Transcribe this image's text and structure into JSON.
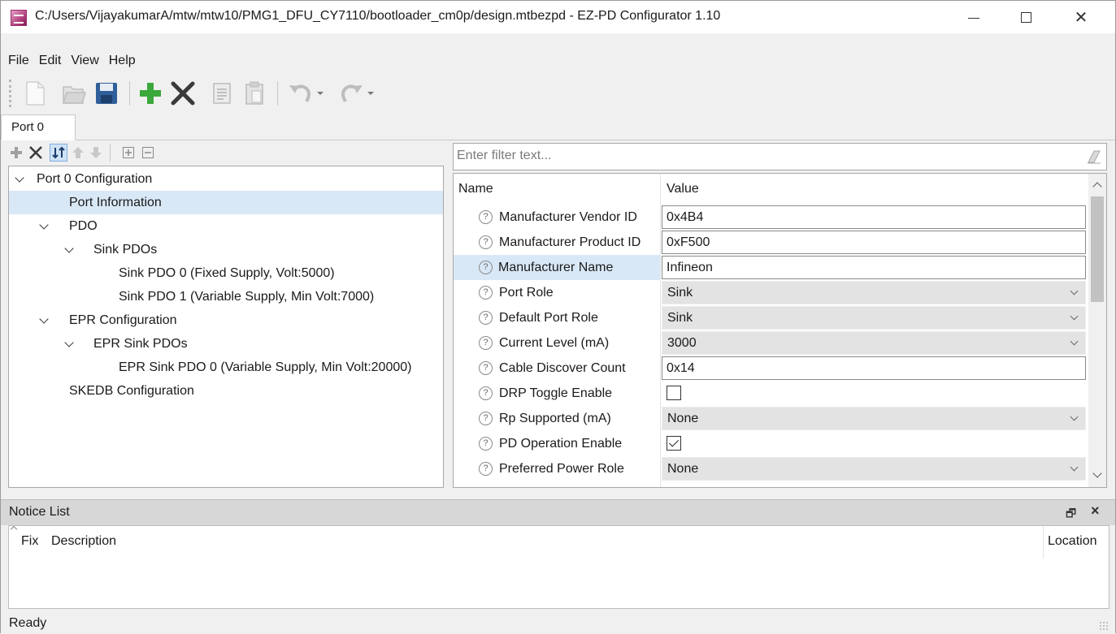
{
  "window": {
    "title": "C:/Users/VijayakumarA/mtw/mtw10/PMG1_DFU_CY7110/bootloader_cm0p/design.mtbezpd - EZ-PD Configurator 1.10",
    "minimize": "minimize-icon",
    "maximize": "maximize-icon",
    "close_glyph": "✕"
  },
  "menu": [
    "File",
    "Edit",
    "View",
    "Help"
  ],
  "toolbar_icons": [
    "new-file-icon",
    "open-folder-icon",
    "save-icon",
    "add-icon",
    "delete-icon",
    "copy-icon",
    "paste-icon",
    "undo-icon",
    "redo-icon"
  ],
  "tabs": [
    {
      "label": "Port 0"
    }
  ],
  "left_toolbar_icons": [
    "add-icon",
    "delete-icon",
    "sort-icon",
    "move-up-icon",
    "move-down-icon",
    "expand-all-icon",
    "collapse-all-icon"
  ],
  "tree": [
    {
      "label": "Port 0 Configuration",
      "level": 0,
      "expanded": true
    },
    {
      "label": "Port Information",
      "level": 1,
      "selected": true
    },
    {
      "label": "PDO",
      "level": 1,
      "expanded": true
    },
    {
      "label": "Sink PDOs",
      "level": 2,
      "expanded": true
    },
    {
      "label": "Sink PDO 0 (Fixed Supply, Volt:5000)",
      "level": 3
    },
    {
      "label": "Sink PDO 1 (Variable Supply, Min Volt:7000)",
      "level": 3
    },
    {
      "label": "EPR Configuration",
      "level": 1,
      "expanded": true
    },
    {
      "label": "EPR Sink PDOs",
      "level": 2,
      "expanded": true
    },
    {
      "label": "EPR Sink PDO 0 (Variable Supply, Min Volt:20000)",
      "level": 3
    },
    {
      "label": "SKEDB Configuration",
      "level": 1
    }
  ],
  "filter": {
    "placeholder": "Enter filter text..."
  },
  "properties": {
    "header": {
      "name": "Name",
      "value": "Value"
    },
    "rows": [
      {
        "name": "Manufacturer Vendor ID",
        "kind": "text",
        "value": "0x4B4"
      },
      {
        "name": "Manufacturer Product ID",
        "kind": "text",
        "value": "0xF500"
      },
      {
        "name": "Manufacturer Name",
        "kind": "text",
        "value": "Infineon",
        "highlighted": true
      },
      {
        "name": "Port Role",
        "kind": "combo",
        "value": "Sink"
      },
      {
        "name": "Default Port Role",
        "kind": "combo",
        "value": "Sink"
      },
      {
        "name": "Current Level (mA)",
        "kind": "combo",
        "value": "3000"
      },
      {
        "name": "Cable Discover Count",
        "kind": "text",
        "value": "0x14"
      },
      {
        "name": "DRP Toggle Enable",
        "kind": "check",
        "checked": false
      },
      {
        "name": "Rp Supported (mA)",
        "kind": "combo",
        "value": "None"
      },
      {
        "name": "PD Operation Enable",
        "kind": "check",
        "checked": true
      },
      {
        "name": "Preferred Power Role",
        "kind": "combo",
        "value": "None"
      }
    ],
    "help_glyph": "?"
  },
  "notice_list": {
    "title": "Notice List",
    "restore_glyph": "🗗",
    "close_glyph": "×",
    "columns": {
      "fix": "Fix",
      "description": "Description",
      "location": "Location"
    }
  },
  "status": {
    "text": "Ready"
  },
  "colors": {
    "selection": "#d9e8f7",
    "add_green": "#3aa83a",
    "save_blue": "#2f5f9a"
  }
}
